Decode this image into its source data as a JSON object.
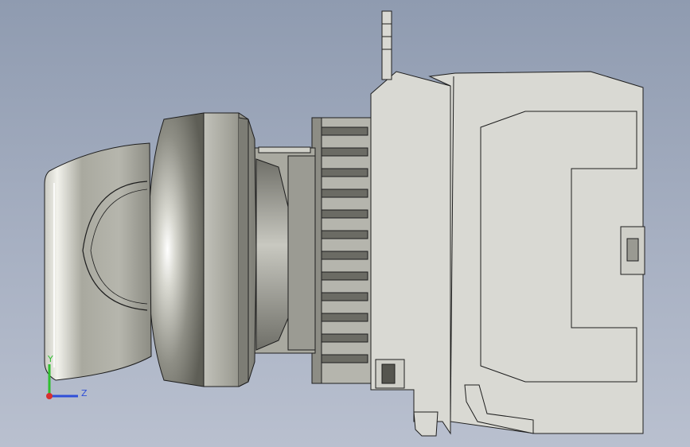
{
  "viewport": {
    "background_top": "#8f9bb0",
    "background_bottom": "#b9c0cf"
  },
  "model": {
    "body_color": "#d9d9d3",
    "edge_color": "#1e1e1e",
    "metal_color": "#9c9c92",
    "dark_metal_color": "#55554f"
  },
  "triad": {
    "y_label": "Y",
    "z_label": "Z",
    "y_color": "#2fbf2f",
    "z_color": "#2f4fd8",
    "x_color": "#d82f2f"
  }
}
